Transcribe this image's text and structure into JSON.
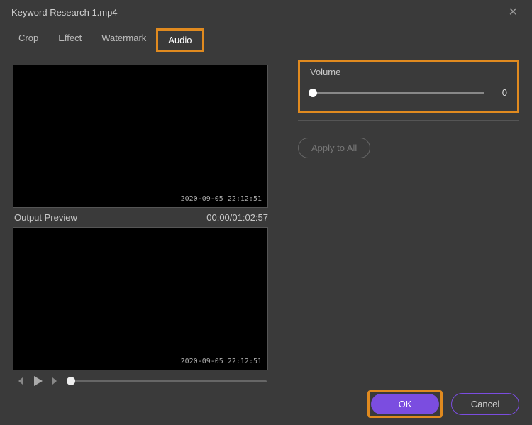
{
  "window": {
    "title": "Keyword Research 1.mp4"
  },
  "tabs": {
    "items": [
      {
        "label": "Crop"
      },
      {
        "label": "Effect"
      },
      {
        "label": "Watermark"
      },
      {
        "label": "Audio"
      }
    ],
    "active_index": 3
  },
  "preview": {
    "source_timestamp": "2020-09-05 22:12:51",
    "output_label": "Output Preview",
    "output_time": "00:00/01:02:57",
    "output_timestamp": "2020-09-05 22:12:51"
  },
  "audio": {
    "volume_label": "Volume",
    "volume_value": "0"
  },
  "buttons": {
    "apply_all": "Apply to All",
    "ok": "OK",
    "cancel": "Cancel"
  }
}
